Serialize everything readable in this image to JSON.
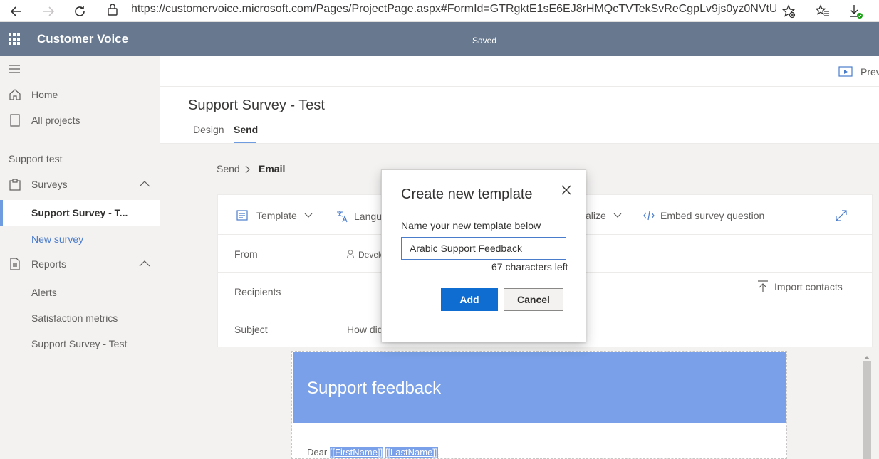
{
  "browser": {
    "url": "https://customervoice.microsoft.com/Pages/ProjectPage.aspx#FormId=GTRgktE1sE6EJ8rHMQcTVTekSvReCgpLv9js0yz0NVtUQ..."
  },
  "header": {
    "app_title": "Customer Voice",
    "status": "Saved"
  },
  "sidebar": {
    "home": "Home",
    "all_projects": "All projects",
    "project_name": "Support test",
    "surveys": "Surveys",
    "survey_selected": "Support Survey - T...",
    "new_survey": "New survey",
    "reports": "Reports",
    "alerts": "Alerts",
    "satisfaction_metrics": "Satisfaction metrics",
    "report_survey": "Support Survey - Test"
  },
  "topbar": {
    "preview": "Prev"
  },
  "page": {
    "title": "Support Survey - Test",
    "tabs": [
      "Design",
      "Send"
    ]
  },
  "breadcrumb": {
    "parent": "Send",
    "current": "Email"
  },
  "toolbar": {
    "template": "Template",
    "language": "Langua",
    "personalize": "alize",
    "embed": "Embed survey question"
  },
  "email": {
    "from_label": "From",
    "from_value": "Develo",
    "recipients_label": "Recipients",
    "import_contacts": "Import contacts",
    "subject_label": "Subject",
    "subject_value": "How did",
    "banner_title": "Support feedback",
    "greeting_prefix": "Dear ",
    "token_first": "[[FirstName]]",
    "token_last": "[[LastName]]",
    "greeting_suffix": ","
  },
  "dialog": {
    "title": "Create new template",
    "label": "Name your new template below",
    "input_value": "Arabic Support Feedback",
    "chars_left": "67 characters left",
    "add": "Add",
    "cancel": "Cancel"
  },
  "colors": {
    "header_bg": "#68798f",
    "accent": "#0f6cd1",
    "banner": "#79a0e8",
    "selected_bar": "#6f9be0",
    "link": "#4a7ccc"
  }
}
